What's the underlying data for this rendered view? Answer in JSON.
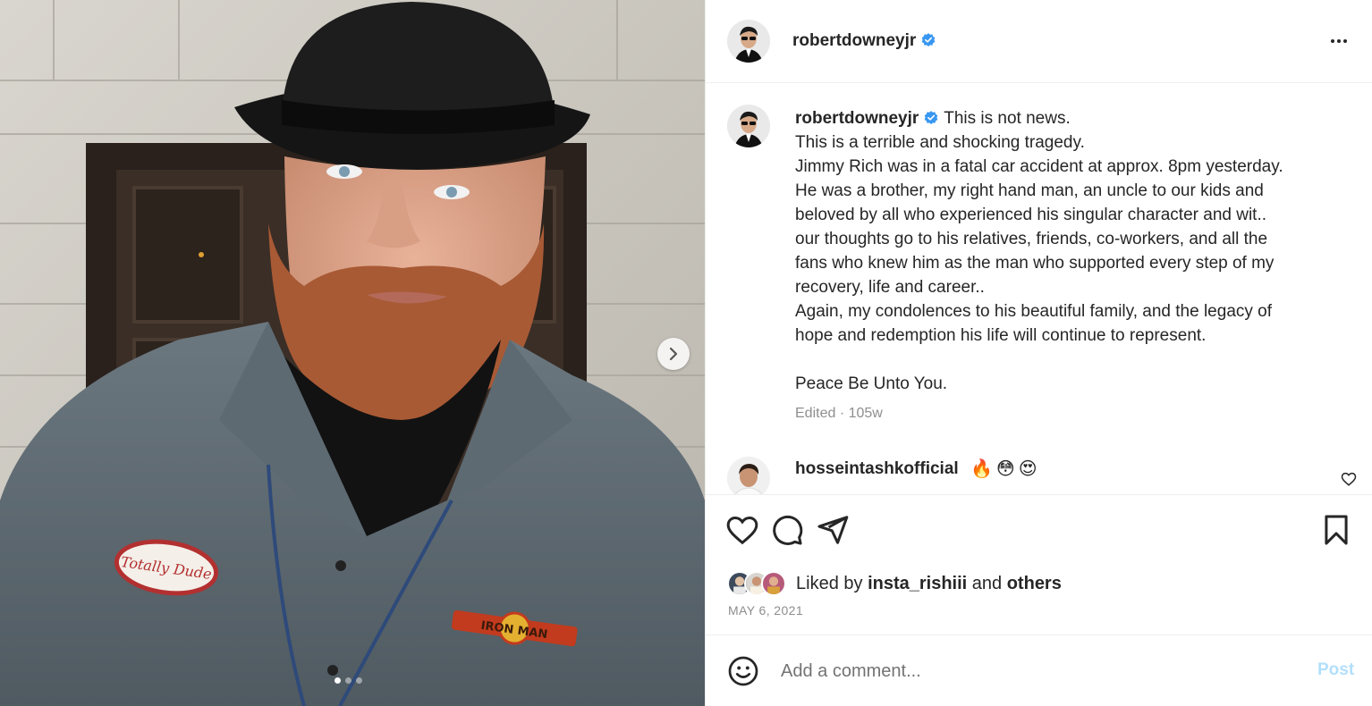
{
  "post": {
    "username": "robertdowneyjr",
    "verified": true,
    "caption_lines": [
      "This is not news.",
      "This is a terrible and shocking tragedy.",
      "Jimmy Rich was in a fatal car accident at approx. 8pm yesterday.",
      "He was a brother, my right hand man, an uncle to our kids and",
      "beloved by all who experienced his singular character and wit..",
      "our thoughts go to his relatives, friends, co-workers, and all the",
      "fans who knew him as the man who supported every step of my",
      "recovery, life and career..",
      "Again, my condolences to his beautiful family, and the legacy of",
      "hope and redemption his life will continue to represent.",
      "",
      "Peace Be Unto You."
    ],
    "meta": "Edited · 105w",
    "date": "MAY 6, 2021"
  },
  "comment": {
    "username": "hosseintashkofficial",
    "text": "🔥😳😍"
  },
  "likes": {
    "prefix": "Liked by",
    "user": "insta_rishiii",
    "joiner": "and",
    "others": "others"
  },
  "add_comment": {
    "placeholder": "Add a comment...",
    "post_label": "Post"
  },
  "carousel": {
    "count": 3,
    "active_index": 0
  },
  "photo_text": {
    "patch": "Totally Dude",
    "logo": "IRON MAN"
  },
  "colors": {
    "verified": "#3897f0",
    "post_disabled": "#b2dffc",
    "muted": "#8e8e8e"
  },
  "icons": [
    "heart-icon",
    "comment-icon",
    "share-icon",
    "bookmark-icon",
    "emoji-icon",
    "more-icon",
    "chevron-right-icon",
    "verified-icon"
  ]
}
